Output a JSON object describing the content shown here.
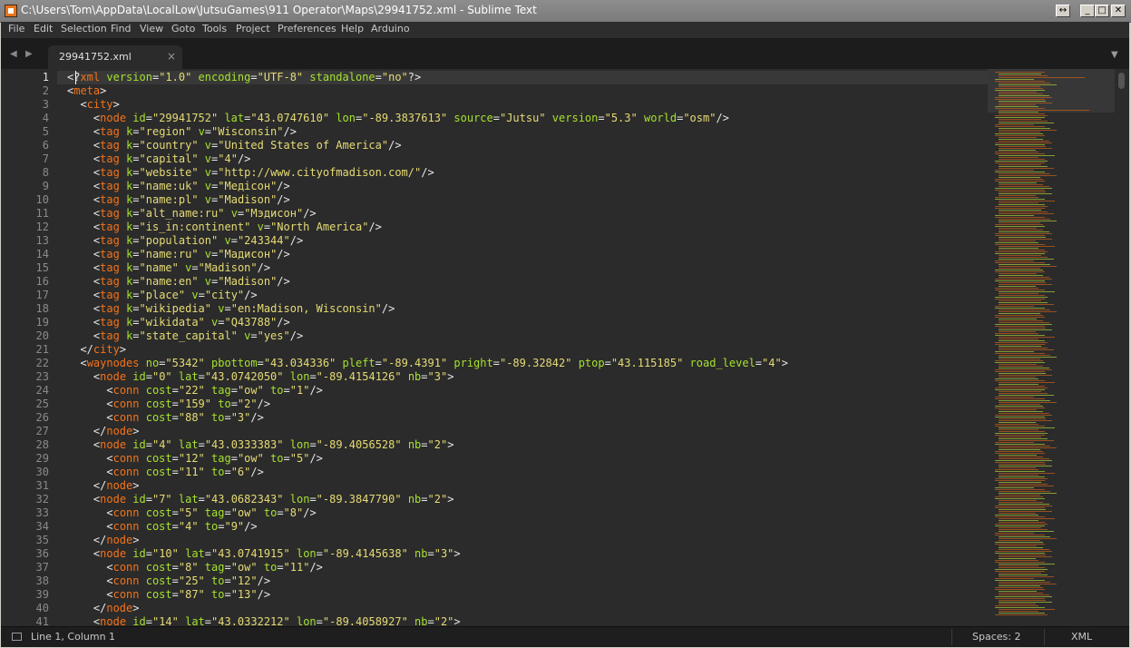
{
  "window": {
    "title": "C:\\Users\\Tom\\AppData\\LocalLow\\JutsuGames\\911 Operator\\Maps\\29941752.xml - Sublime Text",
    "controls": {
      "resize": "↔",
      "minimize": "_",
      "maximize": "□",
      "close": "✕"
    }
  },
  "menu": [
    "File",
    "Edit",
    "Selection",
    "Find",
    "View",
    "Goto",
    "Tools",
    "Project",
    "Preferences",
    "Help",
    "Arduino"
  ],
  "tabs": [
    {
      "label": "29941752.xml",
      "close": "×",
      "active": true
    }
  ],
  "nav": {
    "back": "◀",
    "forward": "▶",
    "tab_menu": "▼"
  },
  "editor": {
    "current_line": 1,
    "line_numbers": [
      "1",
      "2",
      "3",
      "4",
      "5",
      "6",
      "7",
      "8",
      "9",
      "10",
      "11",
      "12",
      "13",
      "14",
      "15",
      "16",
      "17",
      "18",
      "19",
      "20",
      "21",
      "22",
      "23",
      "24",
      "25",
      "26",
      "27",
      "28",
      "29",
      "30",
      "31",
      "32",
      "33",
      "34",
      "35",
      "36",
      "37",
      "38",
      "39",
      "40",
      "41"
    ],
    "lines": [
      "<?xml version=\"1.0\" encoding=\"UTF-8\" standalone=\"no\"?>",
      "<meta>",
      "  <city>",
      "    <node id=\"29941752\" lat=\"43.0747610\" lon=\"-89.3837613\" source=\"Jutsu\" version=\"5.3\" world=\"osm\"/>",
      "    <tag k=\"region\" v=\"Wisconsin\"/>",
      "    <tag k=\"country\" v=\"United States of America\"/>",
      "    <tag k=\"capital\" v=\"4\"/>",
      "    <tag k=\"website\" v=\"http://www.cityofmadison.com/\"/>",
      "    <tag k=\"name:uk\" v=\"Медісон\"/>",
      "    <tag k=\"name:pl\" v=\"Madison\"/>",
      "    <tag k=\"alt_name:ru\" v=\"Мэдисон\"/>",
      "    <tag k=\"is_in:continent\" v=\"North America\"/>",
      "    <tag k=\"population\" v=\"243344\"/>",
      "    <tag k=\"name:ru\" v=\"Мадисон\"/>",
      "    <tag k=\"name\" v=\"Madison\"/>",
      "    <tag k=\"name:en\" v=\"Madison\"/>",
      "    <tag k=\"place\" v=\"city\"/>",
      "    <tag k=\"wikipedia\" v=\"en:Madison, Wisconsin\"/>",
      "    <tag k=\"wikidata\" v=\"Q43788\"/>",
      "    <tag k=\"state_capital\" v=\"yes\"/>",
      "  </city>",
      "  <waynodes no=\"5342\" pbottom=\"43.034336\" pleft=\"-89.4391\" pright=\"-89.32842\" ptop=\"43.115185\" road_level=\"4\">",
      "    <node id=\"0\" lat=\"43.0742050\" lon=\"-89.4154126\" nb=\"3\">",
      "      <conn cost=\"22\" tag=\"ow\" to=\"1\"/>",
      "      <conn cost=\"159\" to=\"2\"/>",
      "      <conn cost=\"88\" to=\"3\"/>",
      "    </node>",
      "    <node id=\"4\" lat=\"43.0333383\" lon=\"-89.4056528\" nb=\"2\">",
      "      <conn cost=\"12\" tag=\"ow\" to=\"5\"/>",
      "      <conn cost=\"11\" to=\"6\"/>",
      "    </node>",
      "    <node id=\"7\" lat=\"43.0682343\" lon=\"-89.3847790\" nb=\"2\">",
      "      <conn cost=\"5\" tag=\"ow\" to=\"8\"/>",
      "      <conn cost=\"4\" to=\"9\"/>",
      "    </node>",
      "    <node id=\"10\" lat=\"43.0741915\" lon=\"-89.4145638\" nb=\"3\">",
      "      <conn cost=\"8\" tag=\"ow\" to=\"11\"/>",
      "      <conn cost=\"25\" to=\"12\"/>",
      "      <conn cost=\"87\" to=\"13\"/>",
      "    </node>",
      "    <node id=\"14\" lat=\"43.0332212\" lon=\"-89.4058927\" nb=\"2\">"
    ]
  },
  "status": {
    "position": "Line 1, Column 1",
    "indentation": "Spaces: 2",
    "syntax": "XML"
  },
  "colors": {
    "tag": "#f4731a",
    "attribute": "#a6e22e",
    "string": "#e6db74",
    "background": "#2b2b2b"
  }
}
